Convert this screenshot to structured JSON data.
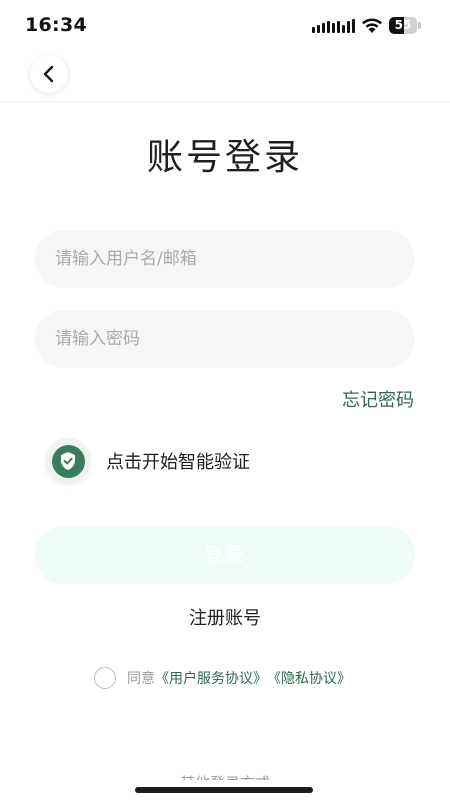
{
  "status_bar": {
    "time": "16:34",
    "battery_level": "55",
    "battery_fraction": 0.55,
    "signal_icon": "signal-bars-icon",
    "wifi_icon": "wifi-icon"
  },
  "header": {
    "back_icon": "chevron-left-icon"
  },
  "title": "账号登录",
  "form": {
    "username_placeholder": "请输入用户名/邮箱",
    "password_placeholder": "请输入密码",
    "forgot_password": "忘记密码"
  },
  "verify": {
    "label": "点击开始智能验证",
    "icon": "shield-check-icon"
  },
  "login_button": "登录",
  "register_link": "注册账号",
  "agreement": {
    "prefix": "同意",
    "user_agreement": "《用户服务协议》",
    "privacy_policy": "《隐私协议》"
  },
  "other_login": "其他登录方式",
  "colors": {
    "accent": "#3a7d5d",
    "link": "#2f6b4f",
    "login_button_bg": "#effcf6",
    "input_bg": "#f6f6f6"
  }
}
